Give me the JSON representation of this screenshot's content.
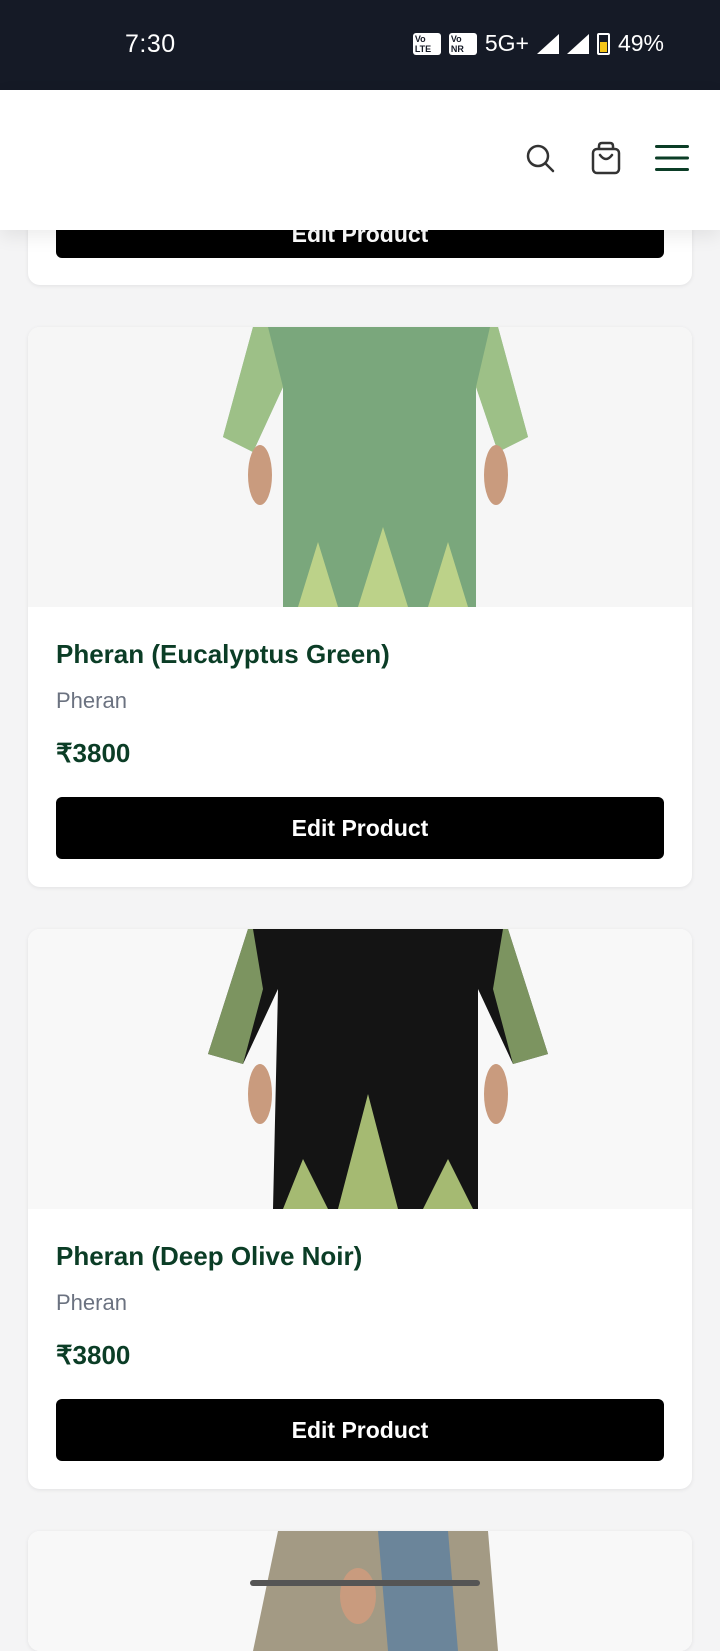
{
  "status": {
    "time": "7:30",
    "network": "5G+",
    "battery": "49%"
  },
  "header": {
    "icons": [
      "search-icon",
      "cart-icon",
      "menu-icon"
    ]
  },
  "top_card": {
    "button_label": "Edit Product"
  },
  "products": [
    {
      "title": "Pheran (Eucalyptus Green)",
      "category": "Pheran",
      "price": "₹3800",
      "button_label": "Edit Product",
      "color": "#7aa77c"
    },
    {
      "title": "Pheran (Deep Olive Noir)",
      "category": "Pheran",
      "price": "₹3800",
      "button_label": "Edit Product",
      "color": "#141414"
    }
  ],
  "colors": {
    "accent": "#0b3d26",
    "button": "#000000"
  }
}
